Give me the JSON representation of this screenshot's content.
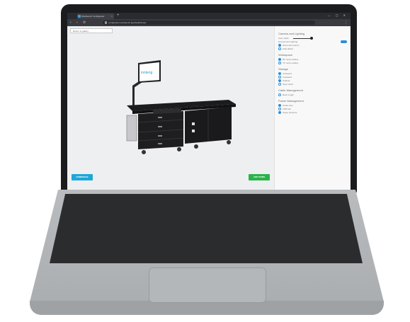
{
  "browser": {
    "tab_title": "Workbench Configurator",
    "tab_close": "×",
    "new_tab": "+",
    "window_controls": "— ▢ ✕",
    "nav": "‹ › ⟳",
    "url": "configurator.workbench.app/build/viewer",
    "menu": "⋮"
  },
  "viewer": {
    "return_link": "Return to gallery",
    "monitor_logo": "ionteng",
    "left_button": "HOMEPAGE",
    "right_button": "ADD ITEMS"
  },
  "panel": {
    "sections": [
      {
        "title": "Camera and Lighting",
        "rows": [
          {
            "label": "Auto rotate",
            "control": "slider"
          },
          {
            "label": "Environment lighting",
            "control": "toggle"
          },
          {
            "label": "Show dimensions",
            "control": "radio-on"
          },
          {
            "label": "Hide labels",
            "control": "radio"
          }
        ]
      },
      {
        "title": "Workspace",
        "rows": [
          {
            "label": "60\" work surface",
            "control": "radio-on"
          },
          {
            "label": "72\" work surface",
            "control": "radio"
          }
        ]
      },
      {
        "title": "Storage",
        "rows": [
          {
            "label": "3 drawers",
            "control": "radio-on"
          },
          {
            "label": "4 drawers",
            "control": "radio"
          },
          {
            "label": "Cabinet",
            "control": "radio-on"
          },
          {
            "label": "Open shelf",
            "control": "radio"
          }
        ]
      },
      {
        "title": "Cable Management",
        "rows": [
          {
            "label": "Rear trough",
            "control": "radio"
          }
        ]
      },
      {
        "title": "Power Management",
        "rows": [
          {
            "label": "Outlet strip",
            "control": "radio-on"
          },
          {
            "label": "USB hub",
            "control": "radio"
          },
          {
            "label": "Surge protector",
            "control": "radio-on"
          }
        ]
      }
    ]
  },
  "colors": {
    "accent_blue": "#1fa6d8",
    "accent_green": "#2bb34a",
    "desk_black": "#1c1c1e"
  }
}
